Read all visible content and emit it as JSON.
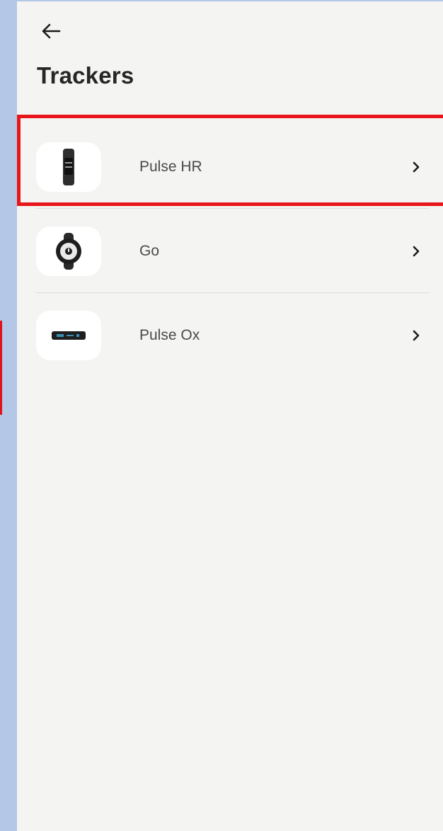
{
  "header": {
    "back_icon": "arrow-left-icon",
    "title": "Trackers"
  },
  "trackers": [
    {
      "label": "Pulse HR",
      "icon": "band-tracker-icon",
      "chevron": "chevron-right-icon",
      "highlighted": true
    },
    {
      "label": "Go",
      "icon": "round-watch-icon",
      "chevron": "chevron-right-icon",
      "highlighted": false
    },
    {
      "label": "Pulse Ox",
      "icon": "slim-band-icon",
      "chevron": "chevron-right-icon",
      "highlighted": false
    }
  ],
  "colors": {
    "background": "#f4f4f2",
    "rail": "#b4c7e6",
    "highlight": "#e8151b",
    "text": "#262626"
  }
}
